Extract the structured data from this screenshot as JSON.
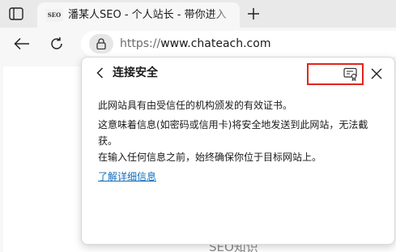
{
  "tab": {
    "favicon_text": "SEO",
    "title": "潘某人SEO - 个人站长 - 带你进入"
  },
  "address": {
    "scheme": "https://",
    "host": "www.chateach.com"
  },
  "popup": {
    "title": "连接安全",
    "paragraphs": [
      "此网站具有由受信任的机构颁发的有效证书。",
      "这意味着信息(如密码或信用卡)将安全地发送到此网站，无法截获。",
      "在输入任何信息之前，始终确保你位于目标网站上。"
    ],
    "link": "了解详细信息"
  },
  "page": {
    "hint_text": "SEO知识"
  },
  "icons": {
    "tab_actions": "tab-actions-icon",
    "new_tab": "plus-icon",
    "back": "arrow-left-icon",
    "refresh": "refresh-icon",
    "site_info": "lock-icon",
    "popup_back": "chevron-left-icon",
    "certificate": "certificate-icon",
    "close": "close-icon"
  },
  "colors": {
    "highlight_border": "#e0251b",
    "link": "#0f6cbd"
  }
}
